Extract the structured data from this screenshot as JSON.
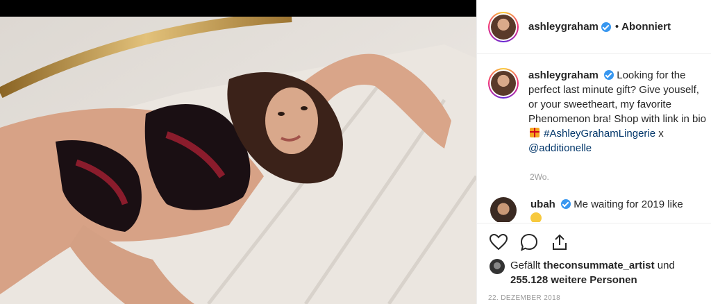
{
  "post": {
    "username": "ashleygraham",
    "follow_status": "Abonniert",
    "separator": "•"
  },
  "caption": {
    "username": "ashleygraham",
    "text_1": "Looking for the perfect last minute gift? Give youself, or your sweetheart, my favorite Phenomenon bra! Shop with link in bio",
    "hashtag": "#AshleyGrahamLingerie",
    "text_2": "x",
    "mention": "@additionelle",
    "time_ago": "2Wo."
  },
  "comment": {
    "username": "ubah",
    "text": "Me waiting for 2019 like"
  },
  "likes": {
    "prefix": "Gefällt",
    "user": "theconsummate_artist",
    "conj": "und",
    "count": "255.128 weitere Personen"
  },
  "date": "22. DEZEMBER 2018",
  "icons": {
    "like": "heart-icon",
    "comment": "comment-bubble-icon",
    "share": "share-icon"
  }
}
